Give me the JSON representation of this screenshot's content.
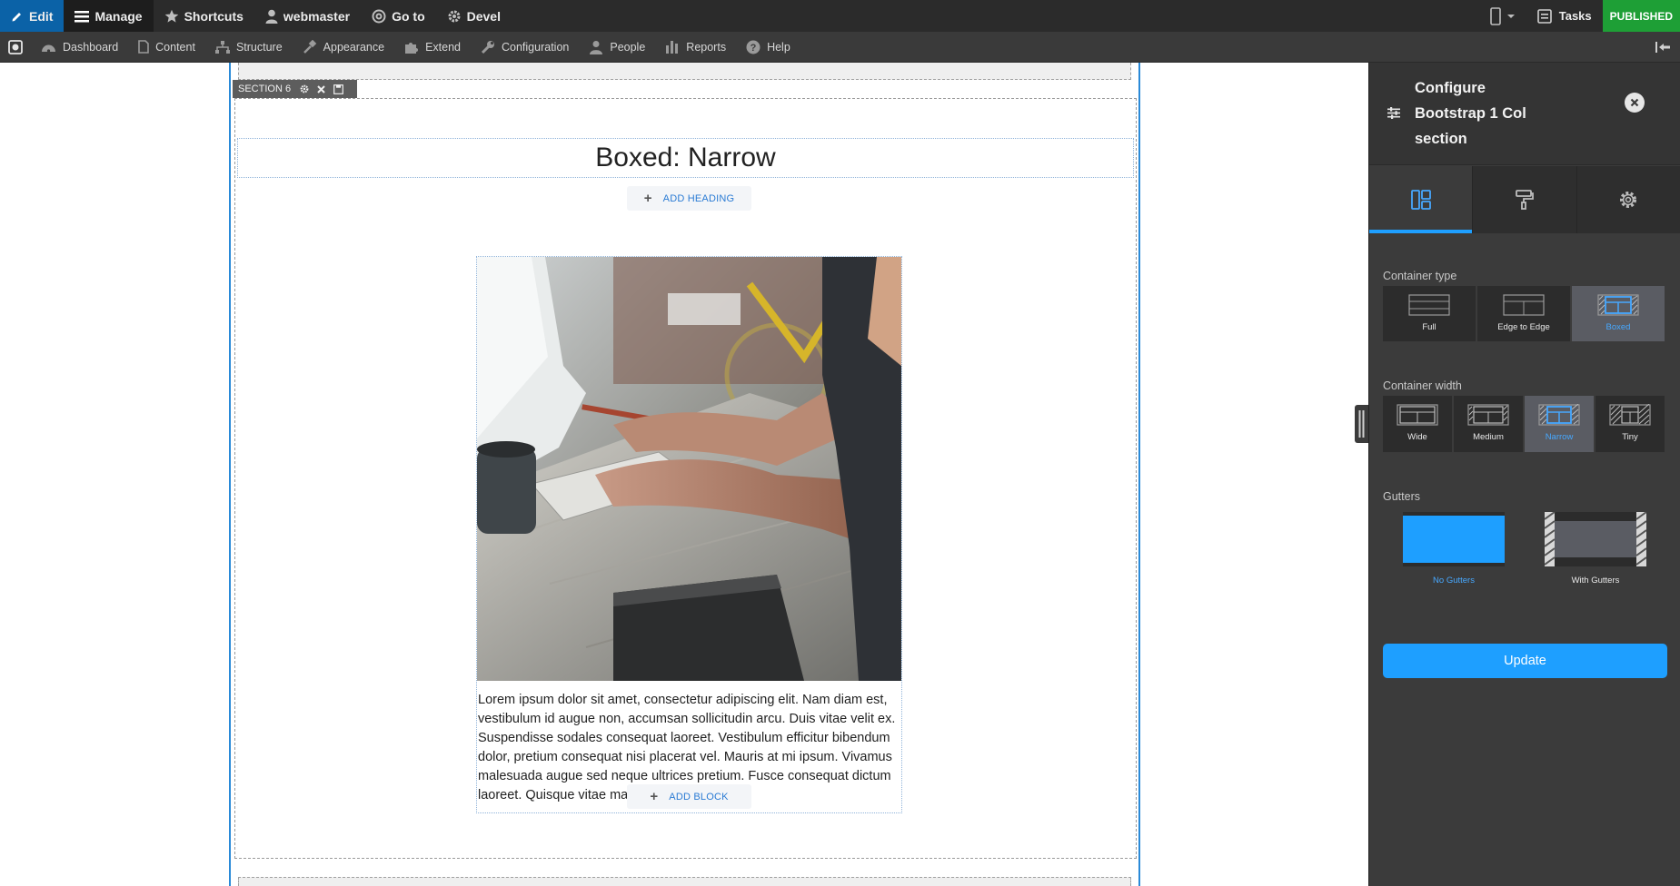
{
  "toolbar": {
    "edit_label": "Edit",
    "manage_label": "Manage",
    "shortcuts_label": "Shortcuts",
    "user_label": "webmaster",
    "goto_label": "Go to",
    "devel_label": "Devel",
    "tasks_label": "Tasks",
    "status_label": "PUBLISHED"
  },
  "menu": {
    "items": [
      {
        "label": "Dashboard",
        "icon": "dashboard-icon"
      },
      {
        "label": "Content",
        "icon": "content-icon"
      },
      {
        "label": "Structure",
        "icon": "structure-icon"
      },
      {
        "label": "Appearance",
        "icon": "appearance-icon"
      },
      {
        "label": "Extend",
        "icon": "extend-icon"
      },
      {
        "label": "Configuration",
        "icon": "configuration-icon"
      },
      {
        "label": "People",
        "icon": "people-icon"
      },
      {
        "label": "Reports",
        "icon": "reports-icon"
      },
      {
        "label": "Help",
        "icon": "help-icon"
      }
    ]
  },
  "canvas": {
    "section_label": "SECTION 6",
    "heading": "Boxed: Narrow",
    "add_heading_label": "ADD HEADING",
    "add_block_label": "ADD BLOCK",
    "body_text": "Lorem ipsum dolor sit amet, consectetur adipiscing elit. Nam diam est, vestibulum id augue non, accumsan sollicitudin arcu. Duis vitae velit ex. Suspendisse sodales consequat laoreet. Vestibulum efficitur bibendum dolor, pretium consequat nisi placerat vel. Mauris at mi ipsum. Vivamus malesuada augue sed neque ultrices pretium. Fusce consequat dictum laoreet. Quisque vitae massa odio."
  },
  "panel": {
    "title": "Configure Bootstrap 1 Col section",
    "tabs": [
      "layout-icon",
      "paint-roller-icon",
      "gear-icon"
    ],
    "container_type": {
      "label": "Container type",
      "options": [
        "Full",
        "Edge to Edge",
        "Boxed"
      ],
      "selected": "Boxed"
    },
    "container_width": {
      "label": "Container width",
      "options": [
        "Wide",
        "Medium",
        "Narrow",
        "Tiny"
      ],
      "selected": "Narrow"
    },
    "gutters": {
      "label": "Gutters",
      "options": [
        "No Gutters",
        "With Gutters"
      ],
      "selected": "No Gutters"
    },
    "update_label": "Update"
  },
  "colors": {
    "accent": "#1e9fff",
    "published": "#1e9f36",
    "edit_active": "#0b62a7"
  }
}
